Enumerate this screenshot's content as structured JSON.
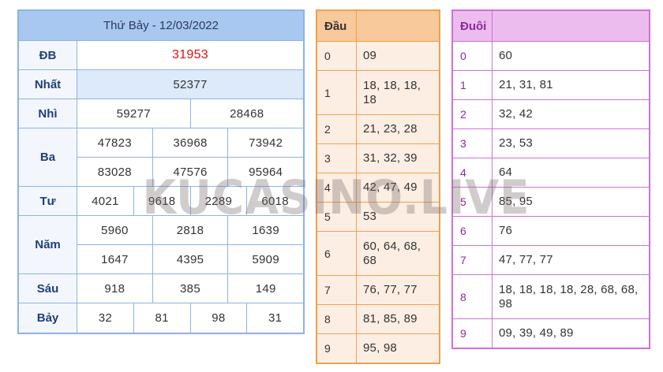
{
  "ketqua": {
    "title": "Thứ Bảy - 12/03/2022",
    "rows": [
      {
        "label": "ĐB",
        "lines": [
          [
            "31953"
          ]
        ]
      },
      {
        "label": "Nhất",
        "lines": [
          [
            "52377"
          ]
        ]
      },
      {
        "label": "Nhì",
        "lines": [
          [
            "59277",
            "28468"
          ]
        ]
      },
      {
        "label": "Ba",
        "lines": [
          [
            "47823",
            "36968",
            "73942"
          ],
          [
            "83028",
            "47576",
            "95964"
          ]
        ]
      },
      {
        "label": "Tư",
        "lines": [
          [
            "4021",
            "9618",
            "2289",
            "6018"
          ]
        ]
      },
      {
        "label": "Năm",
        "lines": [
          [
            "5960",
            "2818",
            "1639"
          ],
          [
            "1647",
            "4395",
            "5909"
          ]
        ]
      },
      {
        "label": "Sáu",
        "lines": [
          [
            "918",
            "385",
            "149"
          ]
        ]
      },
      {
        "label": "Bảy",
        "lines": [
          [
            "32",
            "81",
            "98",
            "31"
          ]
        ]
      }
    ]
  },
  "dau": {
    "header": "Đầu",
    "rows": [
      {
        "key": "0",
        "value": "09"
      },
      {
        "key": "1",
        "value": "18, 18, 18, 18"
      },
      {
        "key": "2",
        "value": "21, 23, 28"
      },
      {
        "key": "3",
        "value": "31, 32, 39"
      },
      {
        "key": "4",
        "value": "42, 47, 49"
      },
      {
        "key": "5",
        "value": "53"
      },
      {
        "key": "6",
        "value": "60, 64, 68, 68"
      },
      {
        "key": "7",
        "value": "76, 77, 77"
      },
      {
        "key": "8",
        "value": "81, 85, 89"
      },
      {
        "key": "9",
        "value": "95, 98"
      }
    ]
  },
  "duoi": {
    "header": "Đuôi",
    "rows": [
      {
        "key": "0",
        "value": "60"
      },
      {
        "key": "1",
        "value": "21, 31, 81"
      },
      {
        "key": "2",
        "value": "32, 42"
      },
      {
        "key": "3",
        "value": "23, 53"
      },
      {
        "key": "4",
        "value": "64"
      },
      {
        "key": "5",
        "value": "85, 95"
      },
      {
        "key": "6",
        "value": "76"
      },
      {
        "key": "7",
        "value": "47, 77, 77"
      },
      {
        "key": "8",
        "value": "18, 18, 18, 18, 28, 68, 68, 98"
      },
      {
        "key": "9",
        "value": "09, 39, 49, 89"
      }
    ]
  },
  "watermark": "KUCASINO.LIVE",
  "colors": {
    "special_prize": "#e01010",
    "result_border": "#8cb3e6",
    "dau_border": "#f0a050",
    "duoi_border": "#d070d8"
  }
}
